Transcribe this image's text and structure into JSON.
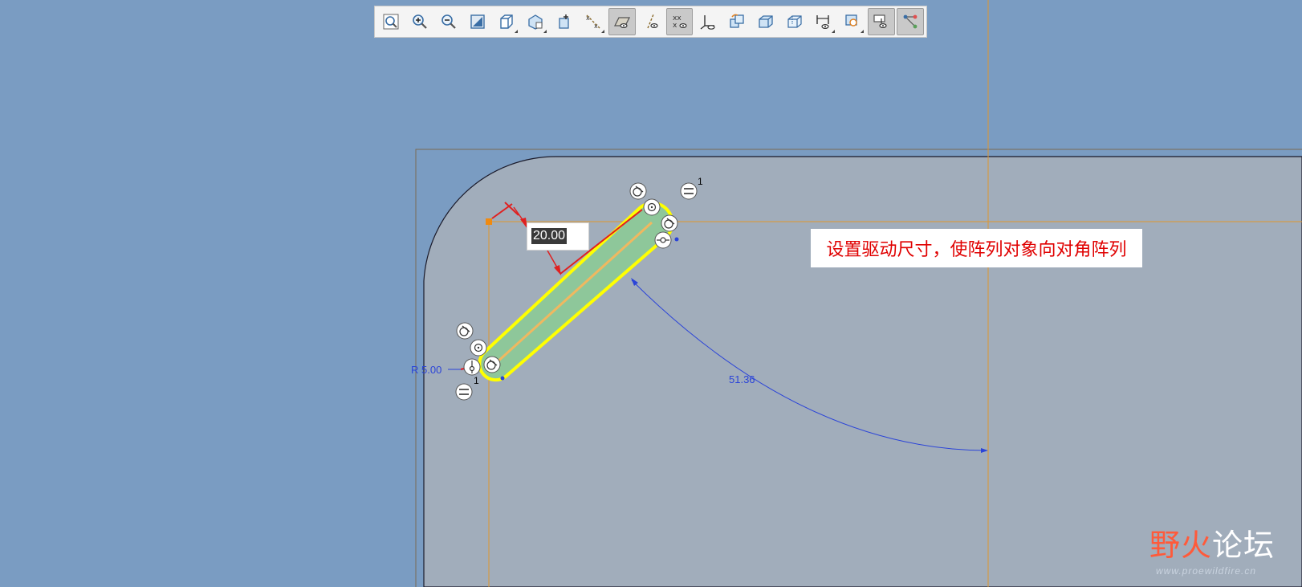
{
  "toolbar": {
    "items": [
      {
        "name": "refit-button",
        "icon": "refit-icon",
        "active": false
      },
      {
        "name": "zoom-in-button",
        "icon": "zoom-in-icon",
        "active": false
      },
      {
        "name": "zoom-out-button",
        "icon": "zoom-out-icon",
        "active": false
      },
      {
        "name": "repaint-button",
        "icon": "repaint-icon",
        "active": false
      },
      {
        "name": "display-style-button",
        "icon": "display-style-icon",
        "active": false
      },
      {
        "name": "saved-orientations-button",
        "icon": "saved-views-icon",
        "active": false
      },
      {
        "name": "view-manager-button",
        "icon": "view-manager-icon",
        "active": false
      },
      {
        "name": "datum-display-button",
        "icon": "datum-filters-icon",
        "active": false
      },
      {
        "name": "sketch-view-button",
        "icon": "sketch-view-icon",
        "active": true
      },
      {
        "name": "axis-display-button",
        "icon": "axis-display-icon",
        "active": false
      },
      {
        "name": "point-display-button",
        "icon": "point-display-icon",
        "active": true
      },
      {
        "name": "csys-display-button",
        "icon": "csys-display-icon",
        "active": false
      },
      {
        "name": "spin-center-button",
        "icon": "spin-center-icon",
        "active": false
      },
      {
        "name": "shading-button",
        "icon": "shading-icon",
        "active": false
      },
      {
        "name": "wireframe-button",
        "icon": "wireframe-icon",
        "active": false
      },
      {
        "name": "dimension-display-button",
        "icon": "dimension-display-icon",
        "active": false
      },
      {
        "name": "constraint-display-button",
        "icon": "constraint-display-icon",
        "active": false
      },
      {
        "name": "vertex-display-button",
        "icon": "vertex-display-icon",
        "active": true
      },
      {
        "name": "grid-display-button",
        "icon": "grid-display-icon",
        "active": true
      }
    ]
  },
  "sketch": {
    "driving_dimension": "20.00",
    "radius_label": "R 5.00",
    "angle_label": "51.36",
    "constraint_index_top": "1",
    "constraint_index_bottom": "1"
  },
  "callout": {
    "text": "设置驱动尺寸，使阵列对象向对角阵列"
  },
  "watermark": {
    "title_part1": "野",
    "title_part2": "火",
    "title_part3": "论坛",
    "url": "www.proewildfire.cn"
  },
  "colors": {
    "background": "#7a9cc2",
    "part_face": "#a1adbb",
    "slot_fill": "#8ec79a",
    "highlight": "#ffff00",
    "reference": "#e0962e",
    "dimension": "#2b44d8",
    "driving_dim": "#e02020"
  }
}
